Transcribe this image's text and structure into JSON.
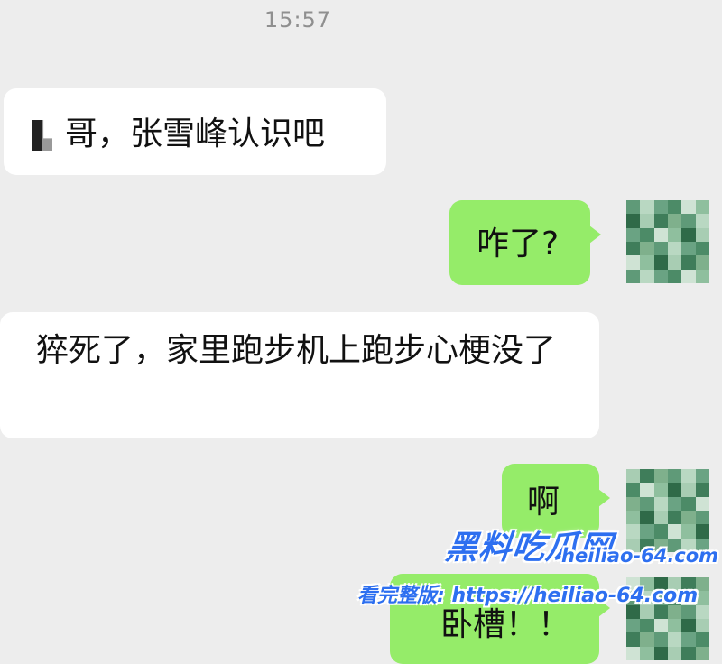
{
  "chat": {
    "timestamp": "15:57",
    "messages": [
      {
        "direction": "incoming",
        "text": "哥，张雪峰认识吧",
        "redacted_prefix": true
      },
      {
        "direction": "outgoing",
        "text": "咋了?"
      },
      {
        "direction": "incoming",
        "text": "猝死了，家里跑步机上跑步心梗没了"
      },
      {
        "direction": "outgoing",
        "text": "啊"
      },
      {
        "direction": "outgoing",
        "text": "卧槽！！"
      }
    ]
  },
  "avatars": {
    "outgoing": "pixelated-avatar"
  },
  "watermark": {
    "logo_text": "黑料吃瓜网",
    "url": "heiliao-64.com",
    "full_version_text": "看完整版: https://heiliao-64.com"
  },
  "colors": {
    "background": "#ededed",
    "incoming_bubble": "#ffffff",
    "outgoing_bubble": "#95ec69",
    "timestamp_text": "#8f8f8f",
    "watermark": "#2d6ff0"
  }
}
